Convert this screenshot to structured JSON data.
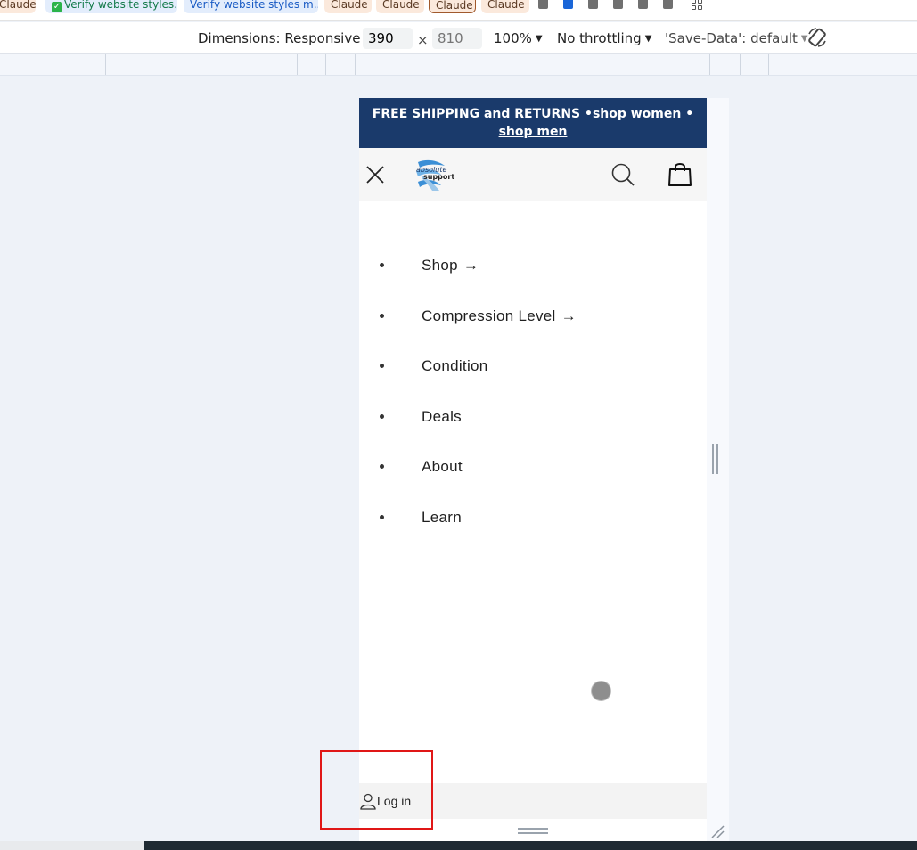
{
  "bookmarks": [
    {
      "label": "Claude",
      "style": "claude"
    },
    {
      "label": "Verify website styles...",
      "style": "green",
      "check": true
    },
    {
      "label": "Verify website styles m...",
      "style": "blue"
    },
    {
      "label": "Claude",
      "style": "claude"
    },
    {
      "label": "Claude",
      "style": "claude"
    },
    {
      "label": "Claude",
      "style": "claude-outlined"
    },
    {
      "label": "Claude",
      "style": "claude"
    }
  ],
  "device_toolbar": {
    "dimensions_label": "Dimensions: Responsive",
    "width_value": "390",
    "height_placeholder": "810",
    "times_sign": "×",
    "zoom_label": "100%",
    "throttling_label": "No throttling",
    "save_data_label": "'Save-Data': default",
    "caret": "▼"
  },
  "site": {
    "announcement": {
      "prefix": "FREE SHIPPING and RETURNS •",
      "link_women": "shop women",
      "separator": " • ",
      "link_men": "shop men"
    },
    "menu": [
      {
        "label": "Shop",
        "arrow": "→"
      },
      {
        "label": "Compression Level",
        "arrow": "→"
      },
      {
        "label": "Condition",
        "arrow": ""
      },
      {
        "label": "Deals",
        "arrow": ""
      },
      {
        "label": "About",
        "arrow": ""
      },
      {
        "label": "Learn",
        "arrow": ""
      }
    ],
    "login_label": "Log in"
  },
  "colors": {
    "announcement_bg": "#1a3a6b",
    "highlight": "#e01717",
    "device_bg": "#eef2f8"
  },
  "icons": [
    "close-icon",
    "logo",
    "search-icon",
    "bag-icon",
    "user-icon",
    "rotate-icon"
  ]
}
